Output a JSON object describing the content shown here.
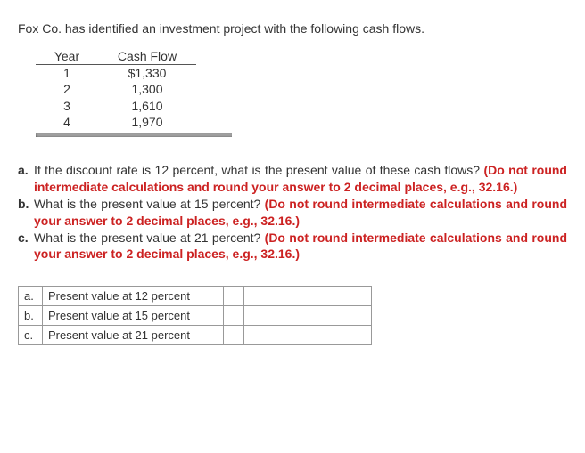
{
  "intro": "Fox Co. has identified an investment project with the following cash flows.",
  "cash_table": {
    "headers": {
      "year": "Year",
      "cf": "Cash Flow"
    },
    "rows": [
      {
        "year": "1",
        "cf": "$1,330"
      },
      {
        "year": "2",
        "cf": "1,300"
      },
      {
        "year": "3",
        "cf": "1,610"
      },
      {
        "year": "4",
        "cf": "1,970"
      }
    ]
  },
  "questions": {
    "a": {
      "label": "a.",
      "text": "If the discount rate is 12 percent, what is the present value of these cash flows? ",
      "hint": "(Do not round intermediate calculations and round your answer to 2 decimal places, e.g., 32.16.)"
    },
    "b": {
      "label": "b.",
      "text": "What is the present value at 15 percent? ",
      "hint": "(Do not round intermediate calculations and round your answer to 2 decimal places, e.g., 32.16.)"
    },
    "c": {
      "label": "c.",
      "text": "What is the present value at 21 percent? ",
      "hint": "(Do not round intermediate calculations and round your answer to 2 decimal places, e.g., 32.16.)"
    }
  },
  "answers": {
    "rows": [
      {
        "label": "a.",
        "desc": "Present value at 12 percent"
      },
      {
        "label": "b.",
        "desc": "Present value at 15 percent"
      },
      {
        "label": "c.",
        "desc": "Present value at 21 percent"
      }
    ]
  }
}
